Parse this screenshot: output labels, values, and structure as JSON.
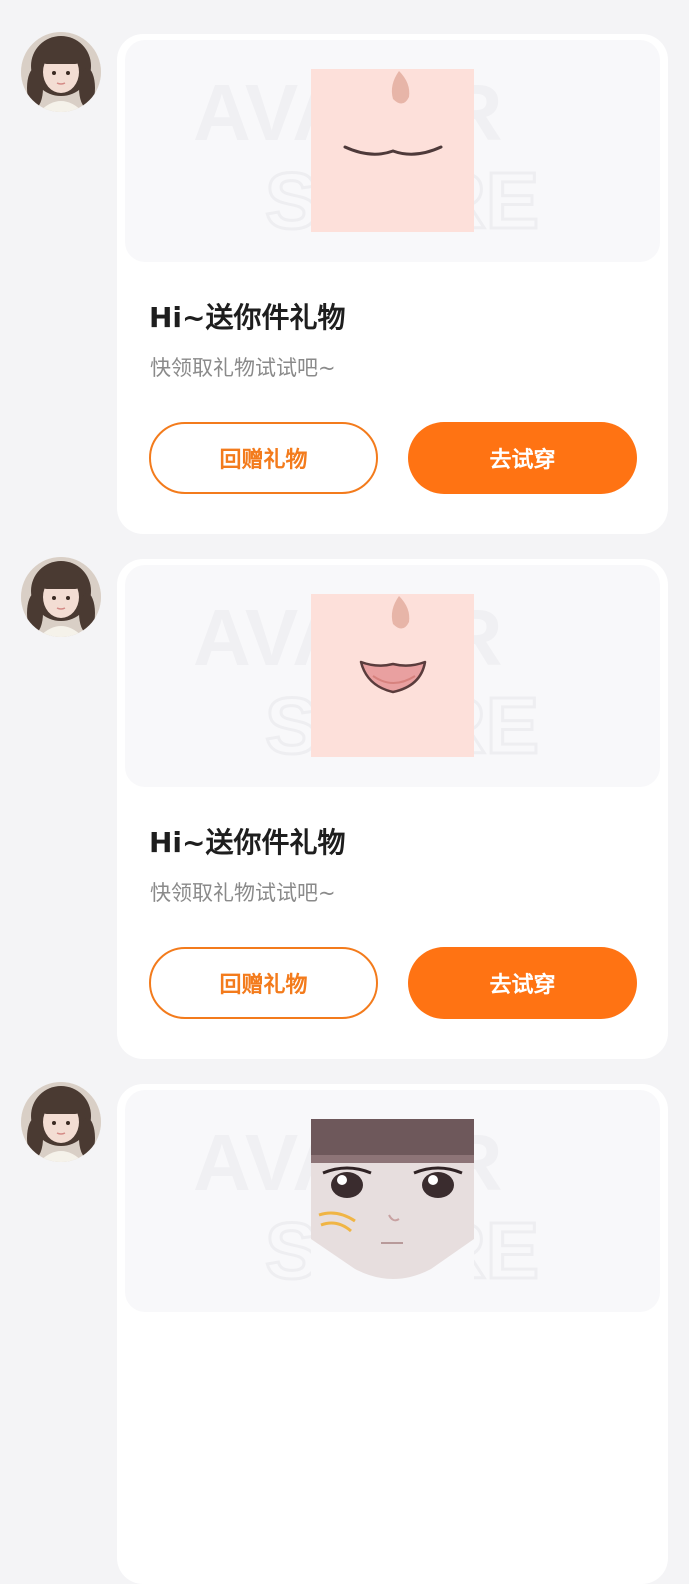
{
  "messages": [
    {
      "avatar_icon": "user-avatar",
      "gift_icon": "mouth-smile-item",
      "title": "Hi~送你件礼物",
      "subtitle": "快领取礼物试试吧~",
      "return_gift_label": "回赠礼物",
      "try_on_label": "去试穿"
    },
    {
      "avatar_icon": "user-avatar",
      "gift_icon": "mouth-tongue-item",
      "title": "Hi~送你件礼物",
      "subtitle": "快领取礼物试试吧~",
      "return_gift_label": "回赠礼物",
      "try_on_label": "去试穿"
    },
    {
      "avatar_icon": "user-avatar",
      "gift_icon": "face-makeup-item",
      "title": "",
      "subtitle": "",
      "return_gift_label": "",
      "try_on_label": ""
    }
  ],
  "colors": {
    "accent": "#ff7313",
    "outline": "#f37b1c",
    "page_bg": "#f4f4f6",
    "card_bg": "#ffffff"
  }
}
